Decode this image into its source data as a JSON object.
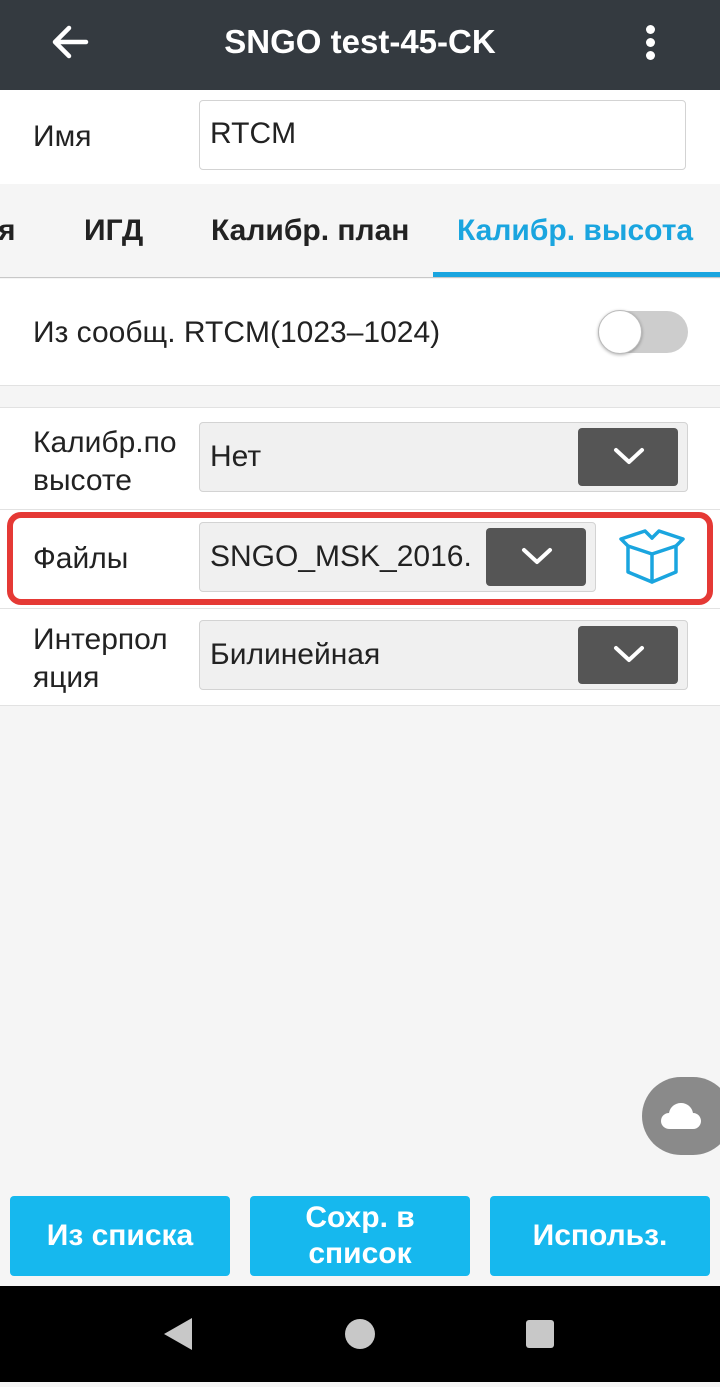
{
  "appbar": {
    "title": "SNGO test-45-CK",
    "back_icon": "arrow-left-icon",
    "menu_icon": "more-vert-icon"
  },
  "name_field": {
    "label": "Имя",
    "value": "RTCM"
  },
  "tabs": [
    {
      "label": "я",
      "active": false
    },
    {
      "label": "ИГД",
      "active": false
    },
    {
      "label": "Калибр. план",
      "active": false
    },
    {
      "label": "Калибр. высота",
      "active": true
    }
  ],
  "rtcm_toggle": {
    "label": "Из сообщ. RTCM(1023–1024)",
    "state": "off"
  },
  "fields": {
    "calib_height": {
      "label_line1": "Калибр.по",
      "label_line2": "высоте",
      "value": "Нет"
    },
    "files": {
      "label": "Файлы",
      "value": "SNGO_MSK_2016.",
      "extra_icon": "package-box-icon"
    },
    "interpolation": {
      "label_line1": "Интерпол",
      "label_line2": "яция",
      "value": "Билинейная"
    }
  },
  "buttons": {
    "from_list": "Из списка",
    "save_line1": "Сохр. в",
    "save_line2": "список",
    "use": "Использ."
  },
  "colors": {
    "accent": "#1aa5df",
    "button": "#16b8ee",
    "appbar": "#343a40",
    "highlight": "#e53935"
  }
}
